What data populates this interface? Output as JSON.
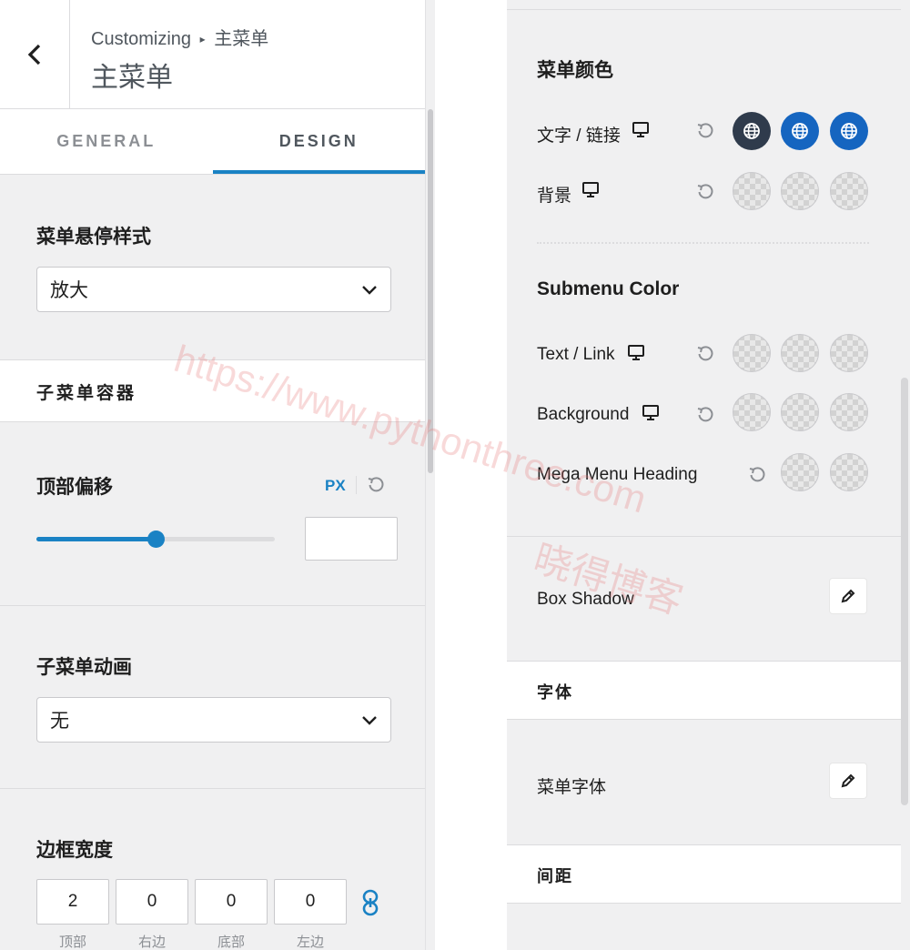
{
  "header": {
    "breadcrumb_root": "Customizing",
    "breadcrumb_arrow": "▸",
    "breadcrumb_current": "主菜单",
    "title": "主菜单"
  },
  "tabs": [
    {
      "label": "GENERAL",
      "active": false
    },
    {
      "label": "DESIGN",
      "active": true
    }
  ],
  "left": {
    "hover_style_label": "菜单悬停样式",
    "hover_style_value": "放大",
    "submenu_container_label": "子菜单容器",
    "top_offset_label": "顶部偏移",
    "top_offset_unit": "PX",
    "top_offset_slider_fraction": 0.5,
    "top_offset_value": "",
    "submenu_anim_label": "子菜单动画",
    "submenu_anim_value": "无",
    "border_width_label": "边框宽度",
    "border_values": [
      "2",
      "0",
      "0",
      "0"
    ],
    "border_labels": [
      "顶部",
      "右边",
      "底部",
      "左边"
    ]
  },
  "right": {
    "menu_color_heading": "菜单颜色",
    "text_link_label": "文字 / 链接",
    "background_label": "背景",
    "text_link_colors": [
      "#2f3b4c",
      "#1565c0",
      "#1565c0"
    ],
    "submenu_color_heading": "Submenu Color",
    "sub_text_link_label": "Text / Link",
    "sub_background_label": "Background",
    "mega_menu_label": "Mega Menu Heading",
    "box_shadow_label": "Box Shadow",
    "font_section_label": "字体",
    "menu_font_label": "菜单字体",
    "spacing_section_label": "间距"
  },
  "watermark": {
    "line1": "https://www.pythonthree.com",
    "line2": "晓得博客"
  },
  "colors": {
    "accent": "#1a82c4",
    "panel_bg": "#f0f0f1"
  }
}
